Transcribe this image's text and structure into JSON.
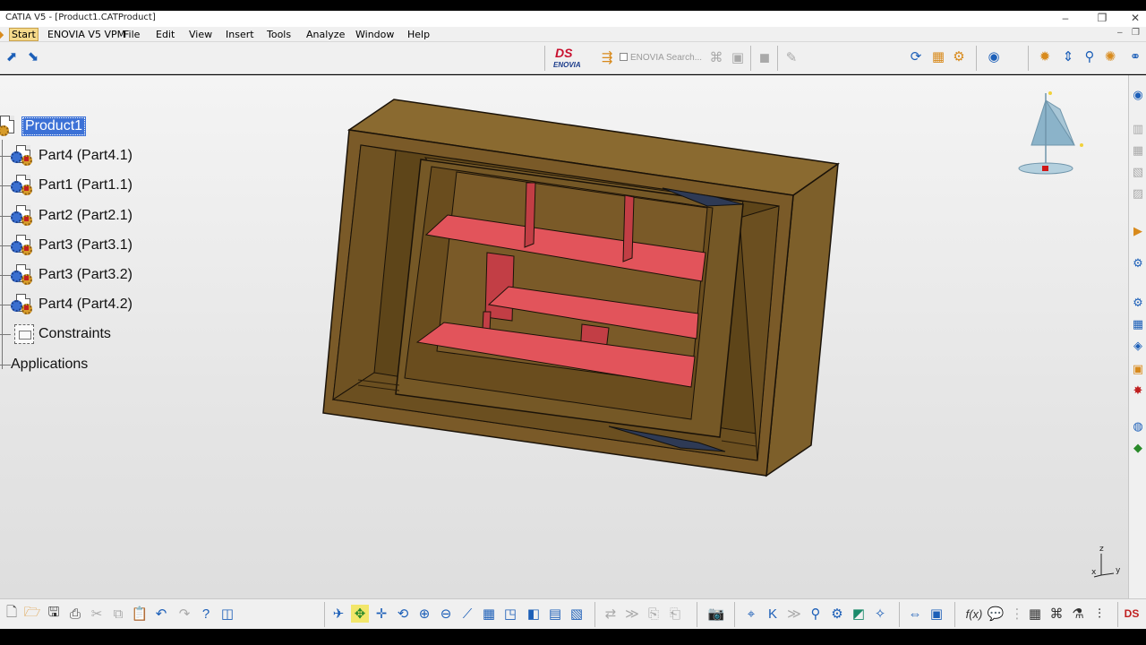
{
  "window": {
    "title": "CATIA V5 - [Product1.CATProduct]",
    "controls": {
      "minimize": "–",
      "restore": "❐",
      "close": "✕"
    }
  },
  "menu": {
    "items": [
      {
        "label": "Start",
        "name": "menu-start"
      },
      {
        "label": "ENOVIA V5 VPM",
        "name": "menu-enovia"
      },
      {
        "label": "File",
        "name": "menu-file"
      },
      {
        "label": "Edit",
        "name": "menu-edit"
      },
      {
        "label": "View",
        "name": "menu-view"
      },
      {
        "label": "Insert",
        "name": "menu-insert"
      },
      {
        "label": "Tools",
        "name": "menu-tools"
      },
      {
        "label": "Analyze",
        "name": "menu-analyze"
      },
      {
        "label": "Window",
        "name": "menu-window"
      },
      {
        "label": "Help",
        "name": "menu-help"
      }
    ],
    "mdi": {
      "minimize": "–",
      "restore": "❐"
    }
  },
  "toolbar": {
    "enovia_search_placeholder": "ENOVIA Search...",
    "ds_logo": "DS",
    "ds_logo_sub": "ENOVIA"
  },
  "tree": {
    "root": "Product1",
    "children": [
      "Part4 (Part4.1)",
      "Part1 (Part1.1)",
      "Part2 (Part2.1)",
      "Part3 (Part3.1)",
      "Part3 (Part3.2)",
      "Part4 (Part4.2)",
      "Constraints",
      "Applications"
    ]
  },
  "compass": {
    "z_label": "z",
    "y_label": "y",
    "x_label": "x"
  },
  "colors": {
    "frame_wood": "#7a5a28",
    "frame_dark": "#4e3a16",
    "inner_red": "#e2545b",
    "selection": "#3c71d6"
  }
}
